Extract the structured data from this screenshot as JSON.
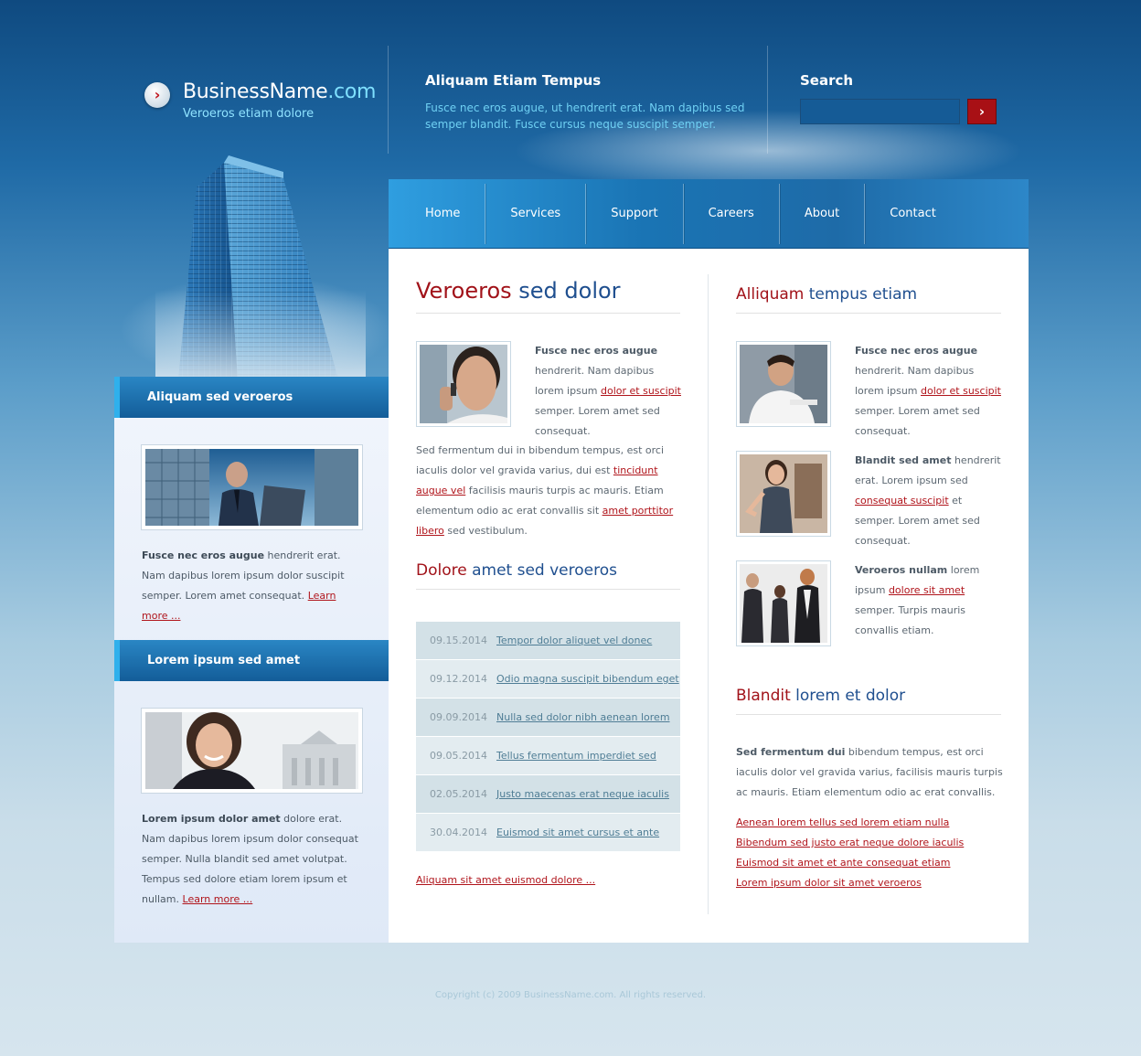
{
  "header": {
    "logo_name": "BusinessName",
    "logo_tld": ".com",
    "tagline": "Veroeros etiam dolore",
    "intro_title": "Aliquam Etiam Tempus",
    "intro_text": "Fusce nec eros augue, ut hendrerit erat. Nam dapibus sed semper blandit. Fusce cursus neque suscipit semper.",
    "search_label": "Search",
    "search_value": ""
  },
  "nav": [
    "Home",
    "Services",
    "Support",
    "Careers",
    "About",
    "Contact"
  ],
  "sidebar": {
    "box1": {
      "title": "Aliquam sed veroeros",
      "bold": "Fusce nec eros augue",
      "text": " hendrerit erat. Nam dapibus lorem ipsum dolor suscipit semper. Lorem amet consequat. ",
      "link": "Learn more ..."
    },
    "box2": {
      "title": "Lorem ipsum sed amet",
      "bold": "Lorem ipsum dolor amet",
      "text": " dolore erat. Nam dapibus lorem ipsum dolor consequat semper. Nulla blandit sed amet volutpat. Tempus sed dolore etiam lorem ipsum et nullam. ",
      "link": "Learn more ..."
    }
  },
  "main": {
    "section1": {
      "title_red": "Veroeros",
      "title_blue": " sed dolor",
      "intro_bold": "Fusce nec eros augue",
      "intro_text1": " hendrerit. Nam dapibus lorem ipsum ",
      "intro_link": "dolor et suscipit",
      "intro_text2": " semper. Lorem amet sed consequat.",
      "para_text1": "Sed fermentum dui in bibendum tempus, est orci iaculis dolor vel gravida varius, dui est ",
      "para_link1": "tincidunt augue vel",
      "para_text2": " facilisis mauris turpis ac mauris. Etiam elementum odio ac erat convallis sit ",
      "para_link2": "amet porttitor libero",
      "para_text3": " sed vestibulum."
    },
    "section2": {
      "title_red": "Dolore",
      "title_blue": " amet sed veroeros",
      "news": [
        {
          "date": "09.15.2014",
          "title": "Tempor dolor aliquet vel donec"
        },
        {
          "date": "09.12.2014",
          "title": "Odio magna suscipit bibendum eget"
        },
        {
          "date": "09.09.2014",
          "title": "Nulla sed dolor nibh aenean lorem"
        },
        {
          "date": "09.05.2014",
          "title": "Tellus fermentum imperdiet sed"
        },
        {
          "date": "02.05.2014",
          "title": "Justo maecenas erat neque iaculis"
        },
        {
          "date": "30.04.2014",
          "title": "Euismod sit amet cursus et ante"
        }
      ],
      "more_link": "Aliquam sit amet euismod dolore ..."
    },
    "section3": {
      "title_red": "Alliquam",
      "title_blue": " tempus etiam",
      "items": [
        {
          "bold": "Fusce nec eros augue",
          "text1": " hendrerit. Nam dapibus lorem ipsum ",
          "link": "dolor et suscipit",
          "text2": " semper. Lorem amet sed consequat."
        },
        {
          "bold": "Blandit sed amet",
          "text1": " hendrerit erat. Lorem ipsum sed ",
          "link": "consequat suscipit",
          "text2": " et semper. Lorem amet sed consequat."
        },
        {
          "bold": "Veroeros nullam",
          "text1": " lorem ipsum ",
          "link": "dolore sit amet",
          "text2": " semper. Turpis mauris convallis etiam."
        }
      ]
    },
    "section4": {
      "title_red": "Blandit",
      "title_blue": " lorem et dolor",
      "bold": "Sed fermentum dui",
      "text": " bibendum tempus, est orci iaculis dolor vel gravida varius, facilisis mauris turpis ac mauris. Etiam elementum odio ac erat convallis.",
      "links": [
        "Aenean lorem tellus sed lorem etiam nulla",
        "Bibendum sed justo erat neque dolore iaculis",
        "Euismod sit amet et ante consequat etiam",
        "Lorem ipsum dolor sit amet veroeros"
      ]
    }
  },
  "footer": "Copyright (c) 2009 BusinessName.com. All rights reserved.",
  "colors": {
    "accent_red": "#a11219",
    "link_red": "#b0141b",
    "heading_blue": "#1f4f8f",
    "nav_blue": "#1a74b4"
  }
}
